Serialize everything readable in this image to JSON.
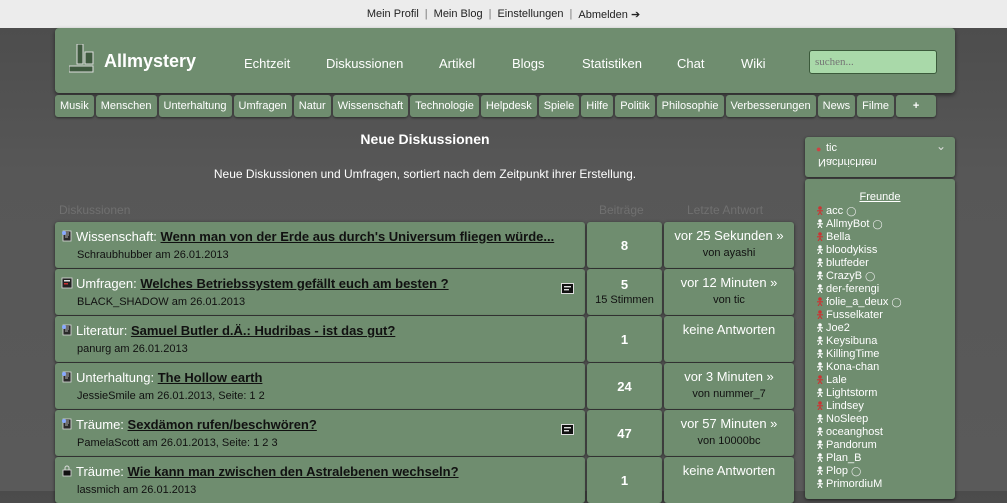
{
  "topbar": [
    "Mein Profil",
    "Mein Blog",
    "Einstellungen",
    "Abmelden ➔"
  ],
  "site": {
    "title": "Allmystery"
  },
  "mainnav": [
    "Echtzeit",
    "Diskussionen",
    "Artikel",
    "Blogs",
    "Statistiken",
    "Chat",
    "Wiki"
  ],
  "search": {
    "placeholder": "suchen..."
  },
  "categories": [
    "Musik",
    "Menschen",
    "Unterhaltung",
    "Umfragen",
    "Natur",
    "Wissenschaft",
    "Technologie",
    "Helpdesk",
    "Spiele",
    "Hilfe",
    "Politik",
    "Philosophie",
    "Verbesserungen",
    "News",
    "Filme",
    "+"
  ],
  "page": {
    "title": "Neue Diskussionen",
    "subtitle": "Neue Diskussionen und Umfragen, sortiert nach dem Zeitpunkt ihrer Erstellung.",
    "col_discussions": "Diskussionen",
    "col_posts": "Beiträge",
    "col_last": "Letzte Antwort"
  },
  "threads": [
    {
      "category": "Wissenschaft:",
      "title": "Wenn man von der Erde aus durch's Universum fliegen würde...",
      "meta": "Schraubhubber am 26.01.2013",
      "count": "8",
      "votes": "",
      "last1": "vor 25 Sekunden »",
      "last2": "von ayashi",
      "icon": "topic",
      "poll": false
    },
    {
      "category": "Umfragen:",
      "title": "Welches Betriebssystem gefällt euch am besten ?",
      "meta": "BLACK_SHADOW am 26.01.2013",
      "count": "5",
      "votes": "15 Stimmen",
      "last1": "vor 12 Minuten »",
      "last2": "von tic",
      "icon": "poll",
      "poll": true
    },
    {
      "category": "Literatur:",
      "title": "Samuel Butler d.Ä.: Hudribas - ist das gut?",
      "meta": "panurg am 26.01.2013",
      "count": "1",
      "votes": "",
      "last1": "keine Antworten",
      "last2": "",
      "icon": "topic",
      "poll": false
    },
    {
      "category": "Unterhaltung:",
      "title": "The Hollow earth",
      "meta": "JessieSmile am 26.01.2013, Seite: 1 2",
      "count": "24",
      "votes": "",
      "last1": "vor 3 Minuten »",
      "last2": "von nummer_7",
      "icon": "topic",
      "poll": false
    },
    {
      "category": "Träume:",
      "title": "Sexdämon rufen/beschwören?",
      "meta": "PamelaScott am 26.01.2013, Seite: 1 2 3",
      "count": "47",
      "votes": "",
      "last1": "vor 57 Minuten »",
      "last2": "von 10000bc",
      "icon": "topic",
      "poll": true
    },
    {
      "category": "Träume:",
      "title": "Wie kann man zwischen den Astralebenen wechseln?",
      "meta": "lassmich am 26.01.2013",
      "count": "1",
      "votes": "",
      "last1": "keine Antworten",
      "last2": "",
      "icon": "lock",
      "poll": false
    }
  ],
  "sidebar": {
    "user": "tic",
    "mirrored": "Nachrichten",
    "friends_heading": "Freunde",
    "friends": [
      {
        "name": "acc",
        "status": "red",
        "eye": true
      },
      {
        "name": "AllmyBot",
        "status": "white",
        "eye": true
      },
      {
        "name": "Bella",
        "status": "red",
        "eye": false
      },
      {
        "name": "bloodykiss",
        "status": "white",
        "eye": false
      },
      {
        "name": "blutfeder",
        "status": "white",
        "eye": false
      },
      {
        "name": "CrazyB",
        "status": "white",
        "eye": true
      },
      {
        "name": "der-ferengi",
        "status": "white",
        "eye": false
      },
      {
        "name": "folie_a_deux",
        "status": "red",
        "eye": true
      },
      {
        "name": "Fusselkater",
        "status": "red",
        "eye": false
      },
      {
        "name": "Joe2",
        "status": "white",
        "eye": false
      },
      {
        "name": "Keysibuna",
        "status": "white",
        "eye": false
      },
      {
        "name": "KillingTime",
        "status": "white",
        "eye": false
      },
      {
        "name": "Kona-chan",
        "status": "white",
        "eye": false
      },
      {
        "name": "Lale",
        "status": "red",
        "eye": false
      },
      {
        "name": "Lightstorm",
        "status": "white",
        "eye": false
      },
      {
        "name": "Lindsey",
        "status": "red",
        "eye": false
      },
      {
        "name": "NoSleep",
        "status": "white",
        "eye": false
      },
      {
        "name": "oceanghost",
        "status": "white",
        "eye": false
      },
      {
        "name": "Pandorum",
        "status": "white",
        "eye": false
      },
      {
        "name": "Plan_B",
        "status": "white",
        "eye": false
      },
      {
        "name": "Plop",
        "status": "white",
        "eye": true
      },
      {
        "name": "PrimordiuM",
        "status": "white",
        "eye": false
      }
    ]
  }
}
